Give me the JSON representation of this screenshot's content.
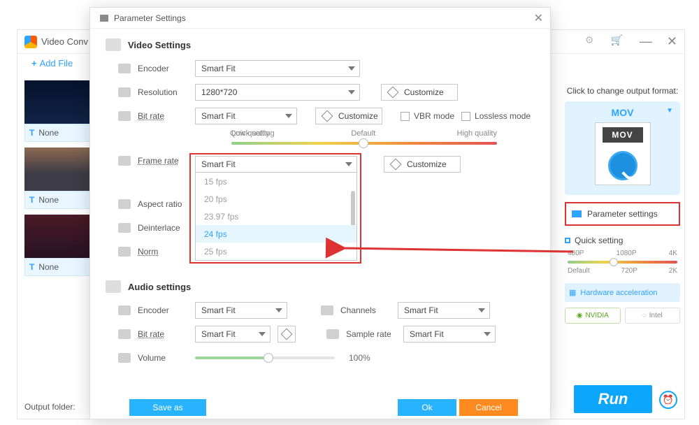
{
  "main": {
    "title": "Video Conv",
    "addFile": "Add File",
    "thumbLabel": "None",
    "outputFolder": "Output folder:"
  },
  "rightPanel": {
    "clickTitle": "Click to change output format:",
    "format": "MOV",
    "movTag": "MOV",
    "paramBtn": "Parameter settings",
    "quick": "Quick setting",
    "scaleTop": {
      "a": "480P",
      "b": "1080P",
      "c": "4K"
    },
    "scaleBot": {
      "a": "Default",
      "b": "720P",
      "c": "2K"
    },
    "hw": "Hardware acceleration",
    "nvidia": "NVIDIA",
    "intel": "Intel",
    "run": "Run"
  },
  "modal": {
    "title": "Parameter Settings",
    "vsTitle": "Video Settings",
    "encoderLabel": "Encoder",
    "encoderVal": "Smart Fit",
    "resLabel": "Resolution",
    "resVal": "1280*720",
    "customize": "Customize",
    "brLabel": "Bit rate",
    "brVal": "Smart Fit",
    "vbr": "VBR mode",
    "lossless": "Lossless mode",
    "qLow": "Low quality",
    "qDef": "Default",
    "qHigh": "High quality",
    "qCaption": "Quick setting",
    "frLabel": "Frame rate",
    "frVal": "Smart Fit",
    "frOptions": [
      "15 fps",
      "20 fps",
      "23.97 fps",
      "24 fps",
      "25 fps"
    ],
    "frHighlightIndex": 3,
    "arLabel": "Aspect ratio",
    "diLabel": "Deinterlace",
    "normLabel": "Norm",
    "asTitle": "Audio settings",
    "aEncLabel": "Encoder",
    "aEncVal": "Smart Fit",
    "chanLabel": "Channels",
    "chanVal": "Smart Fit",
    "aBrLabel": "Bit rate",
    "aBrVal": "Smart Fit",
    "srLabel": "Sample rate",
    "srVal": "Smart Fit",
    "volLabel": "Volume",
    "volPct": "100%",
    "saveAs": "Save as",
    "ok": "Ok",
    "cancel": "Cancel"
  }
}
